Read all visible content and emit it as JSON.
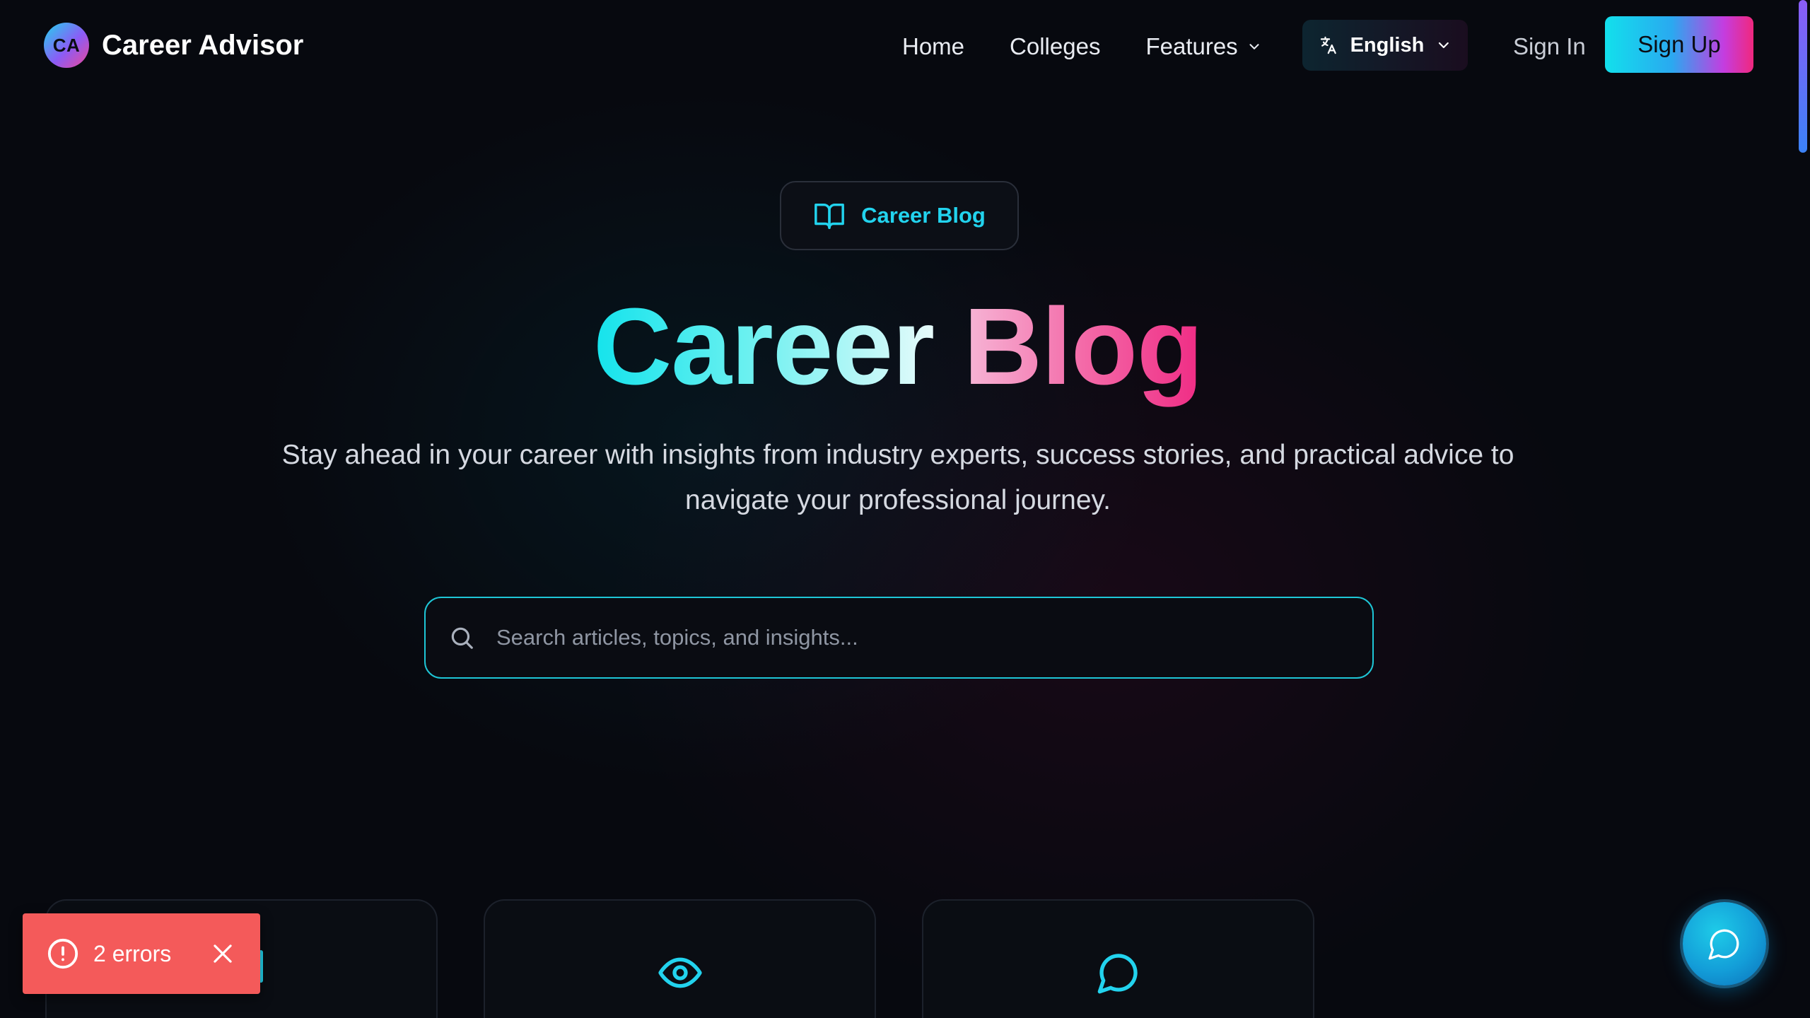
{
  "brand": {
    "logo_text": "CA",
    "name": "Career Advisor"
  },
  "nav": {
    "home": "Home",
    "colleges": "Colleges",
    "features": "Features",
    "language": "English",
    "sign_in": "Sign In",
    "sign_up": "Sign Up"
  },
  "hero": {
    "badge": "Career Blog",
    "title_part1": "Career",
    "title_part2": "Blog",
    "subtitle": "Stay ahead in your career with insights from industry experts, success stories, and practical advice to navigate your professional journey."
  },
  "search": {
    "placeholder": "Search articles, topics, and insights...",
    "value": ""
  },
  "cards": [
    {
      "icon": "accent-bar"
    },
    {
      "icon": "eye-icon"
    },
    {
      "icon": "message-circle-icon"
    }
  ],
  "toast": {
    "label": "2 errors"
  },
  "colors": {
    "accent_cyan": "#22d3ee",
    "accent_pink": "#ec4899",
    "background": "#07090f",
    "error": "#f45a5a"
  }
}
